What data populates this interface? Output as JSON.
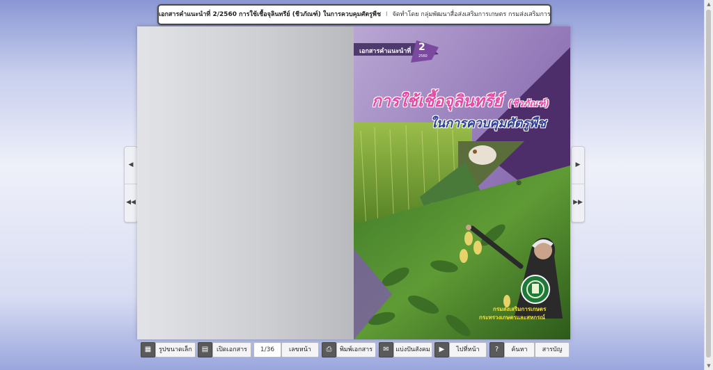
{
  "title": {
    "bold": "เอกสารคำแนะนำที่ 2/2560 การใช้เชื้อจุลินทรีย์ (ชีวภัณฑ์) ในการควบคุมศัตรูพืช",
    "separator": "I",
    "rest": "จัดทำโดย กลุ่มพัฒนาสื่อส่งเสริมการเกษตร กรมส่งเสริมการเกษตร"
  },
  "cover": {
    "series_label": "เอกสารคำแนะนำที่",
    "number": "2",
    "year": "2560",
    "title_line1": "การใช้เชื้อจุลินทรีย์",
    "title_paren": "(ชีวภัณฑ์)",
    "title_line2": "ในการควบคุมศัตรูพืช",
    "org_line1": "กรมส่งเสริมการเกษตร",
    "org_line2": "กระทรวงเกษตรและสหกรณ์"
  },
  "nav": {
    "prev_icon": "◀",
    "first_icon": "◀◀",
    "next_icon": "▶",
    "last_icon": "▶▶"
  },
  "toolbar": {
    "thumbnails_label": "รูปขนาดเล็ก",
    "open_doc_label": "เปิดเอกสาร",
    "page_value": "1/36",
    "page_number_label": "เลขหน้า",
    "print_label": "พิมพ์เอกสาร",
    "share_label": "แบ่งปันสังคม",
    "goto_label": "ไปที่หน้า",
    "search_label": "ค้นหา",
    "toc_label": "สารบัญ"
  },
  "colors": {
    "cover_purple": "#5b3a78",
    "title_pink": "#e64aa6",
    "title_blue": "#2c3e9a",
    "org_yellow": "#f2e43a"
  }
}
